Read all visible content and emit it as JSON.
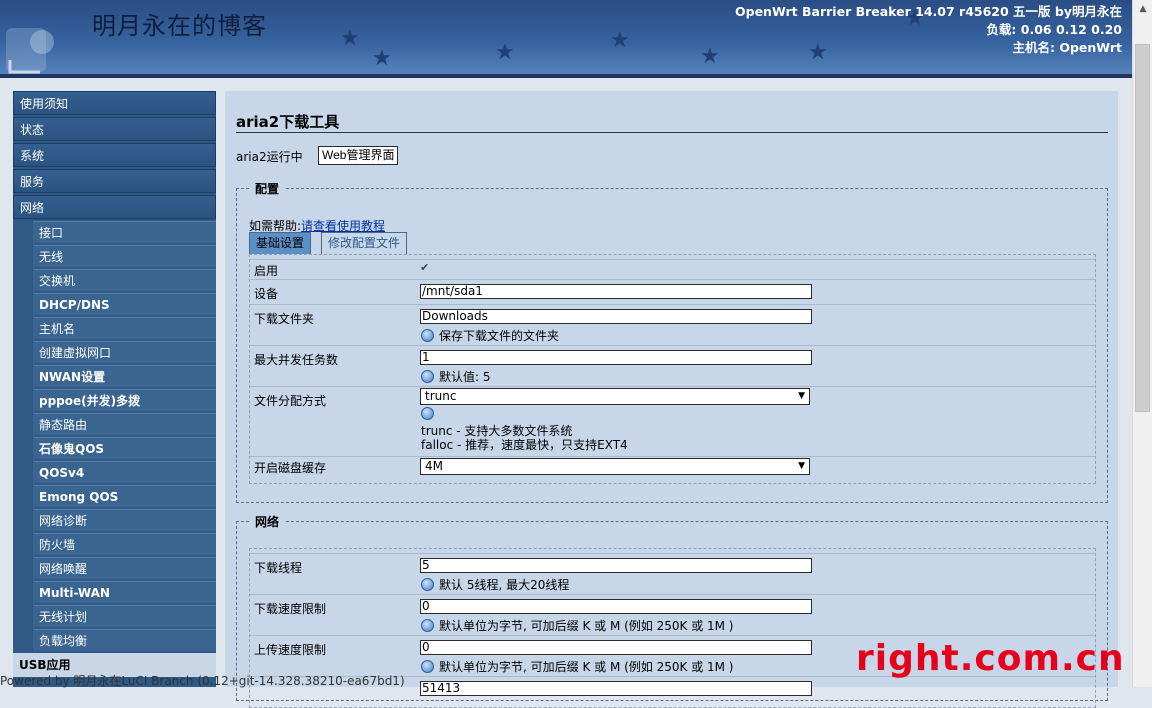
{
  "header": {
    "blog_title": "明月永在的博客",
    "info_line1": "OpenWrt Barrier Breaker 14.07 r45620 五一版 by明月永在",
    "info_line2": "负载: 0.06 0.12 0.20",
    "info_line3": "主机名: OpenWrt"
  },
  "sidebar": {
    "top_items": [
      "使用须知",
      "状态",
      "系统",
      "服务",
      "网络"
    ],
    "sub_items": [
      "接口",
      "无线",
      "交换机",
      "DHCP/DNS",
      "主机名",
      "创建虚拟网口",
      "NWAN设置",
      "pppoe(并发)多拨",
      "静态路由",
      "石像鬼QOS",
      "QOSv4",
      "Emong QOS",
      "网络诊断",
      "防火墙",
      "网络唤醒",
      "Multi-WAN",
      "无线计划",
      "负载均衡"
    ],
    "last_item": "USB应用"
  },
  "main": {
    "title": "aria2下载工具",
    "status": "aria2运行中",
    "web_button": "Web管理界面",
    "config_legend": "配置",
    "help_prefix": "如需帮助:",
    "help_link": "请查看使用教程",
    "tab_basic": "基础设置",
    "tab_edit": "修改配置文件",
    "network_legend": "网络"
  },
  "config": {
    "enable_label": "启用",
    "enable_checked": true,
    "device_label": "设备",
    "device_value": "/mnt/sda1",
    "folder_label": "下载文件夹",
    "folder_value": "Downloads",
    "folder_desc": "保存下载文件的文件夹",
    "maxtask_label": "最大并发任务数",
    "maxtask_value": "1",
    "maxtask_desc": "默认值: 5",
    "alloc_label": "文件分配方式",
    "alloc_value": "trunc",
    "alloc_desc1": "trunc - 支持大多数文件系统",
    "alloc_desc2": "falloc - 推荐，速度最快，只支持EXT4",
    "cache_label": "开启磁盘缓存",
    "cache_value": "4M"
  },
  "network": {
    "threads_label": "下载线程",
    "threads_value": "5",
    "threads_desc": "默认 5线程, 最大20线程",
    "dl_limit_label": "下载速度限制",
    "dl_limit_value": "0",
    "dl_limit_desc": "默认单位为字节, 可加后缀 K 或 M (例如 250K 或 1M )",
    "ul_limit_label": "上传速度限制",
    "ul_limit_value": "0",
    "ul_limit_desc": "默认单位为字节, 可加后缀 K 或 M (例如 250K 或 1M )",
    "port_value": "51413"
  },
  "footer": {
    "text": "Powered by 明月永在LuCI Branch (0.12+git-14.328.38210-ea67bd1)"
  },
  "watermark": {
    "text": "right.com.cn"
  },
  "icons": {
    "help": "help-icon",
    "checkbox": "checkmark-icon",
    "dropdown": "chevron-down-icon"
  }
}
